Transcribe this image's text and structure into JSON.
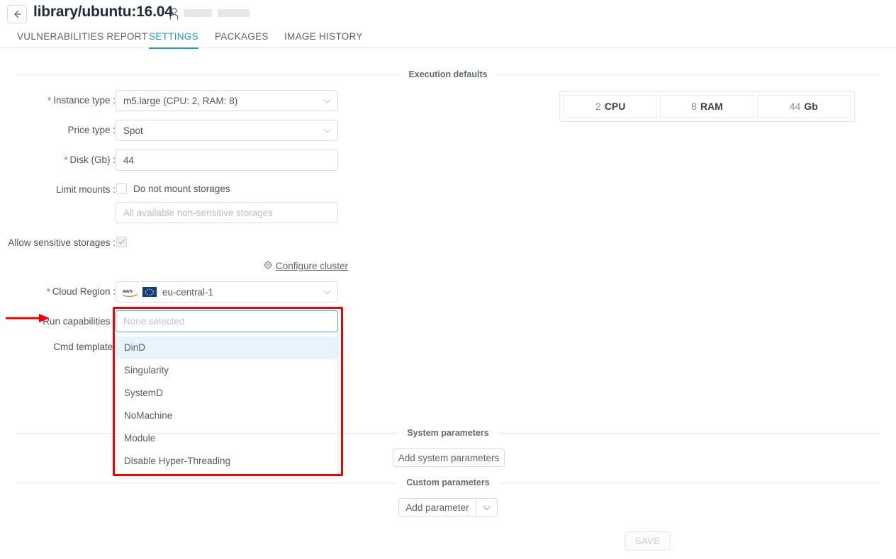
{
  "header": {
    "back_icon": "arrow-left-icon",
    "title": "library/ubuntu:16.04",
    "owner_icon": "user-icon"
  },
  "tabs": [
    {
      "label": "VULNERABILITIES REPORT",
      "active": false
    },
    {
      "label": "SETTINGS",
      "active": true
    },
    {
      "label": "PACKAGES",
      "active": false
    },
    {
      "label": "IMAGE HISTORY",
      "active": false
    }
  ],
  "sections": {
    "execution_defaults": "Execution defaults",
    "system_parameters": "System parameters",
    "custom_parameters": "Custom parameters"
  },
  "form": {
    "instance_type": {
      "label": "Instance type :",
      "required": true,
      "value": "m5.large (CPU: 2, RAM: 8)"
    },
    "price_type": {
      "label": "Price type :",
      "required": false,
      "value": "Spot"
    },
    "disk": {
      "label": "Disk (Gb) :",
      "required": true,
      "value": "44"
    },
    "limit_mounts": {
      "label": "Limit mounts :",
      "checkbox_label": "Do not mount storages",
      "checked": false,
      "storages_value": "All available non-sensitive storages"
    },
    "allow_sensitive_storages": {
      "label": "Allow sensitive storages :",
      "checked": true,
      "disabled": true
    },
    "configure_cluster": {
      "label": "Configure cluster",
      "icon": "gear-icon"
    },
    "cloud_region": {
      "label": "Cloud Region :",
      "required": true,
      "provider_icon": "aws-logo-icon",
      "provider_text": "aws",
      "region_flag_icon": "eu-flag-icon",
      "value": "eu-central-1"
    },
    "run_capabilities": {
      "label": "Run capabilities :",
      "placeholder": "None selected",
      "options": [
        {
          "label": "DinD",
          "highlighted": true
        },
        {
          "label": "Singularity",
          "highlighted": false
        },
        {
          "label": "SystemD",
          "highlighted": false
        },
        {
          "label": "NoMachine",
          "highlighted": false
        },
        {
          "label": "Module",
          "highlighted": false
        },
        {
          "label": "Disable Hyper-Threading",
          "highlighted": false
        }
      ]
    },
    "cmd_template": {
      "label": "Cmd template:"
    }
  },
  "resources": [
    {
      "number": "2",
      "unit": "CPU"
    },
    {
      "number": "8",
      "unit": "RAM"
    },
    {
      "number": "44",
      "unit": "Gb"
    }
  ],
  "buttons": {
    "add_system_parameters": "Add system parameters",
    "add_parameter": "Add parameter",
    "add_parameter_caret_icon": "chevron-down-icon",
    "save": "SAVE",
    "save_disabled": true
  },
  "annotation": {
    "color": "#f50000",
    "arrow_target": "Run capabilities :"
  },
  "colors": {
    "accent": "#1b9ad4",
    "required_star": "#e8433a",
    "annotation": "#f50000",
    "focus_border": "#52a9e8",
    "hover_row": "#e8f4fc"
  }
}
